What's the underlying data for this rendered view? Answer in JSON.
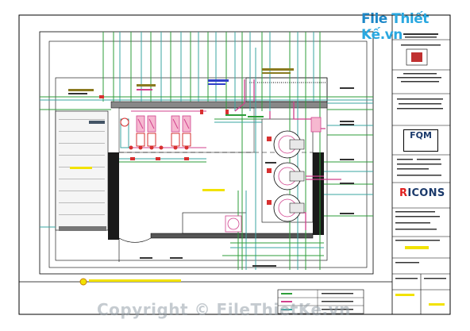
{
  "watermark": {
    "brand_prefix": "File",
    "brand_suffix": "Thiết Kế.vn",
    "copyright": "Copyright © FileThietKe.vn"
  },
  "title_block": {
    "logo_fqm": "FQM",
    "logo_ricons_r": "R",
    "logo_ricons_rest": "ICONS"
  },
  "colors": {
    "paper": "#ffffff",
    "border": "#000000",
    "wall": "#1a1a1a",
    "pipe_green": "#2e9e3a",
    "pipe_teal": "#3aa6a0",
    "pipe_magenta": "#d0408c",
    "pipe_red": "#d83030",
    "label_yellow": "#f2e200",
    "label_olive": "#8a7a20",
    "label_blue": "#3040c8",
    "dash": "#555555"
  }
}
